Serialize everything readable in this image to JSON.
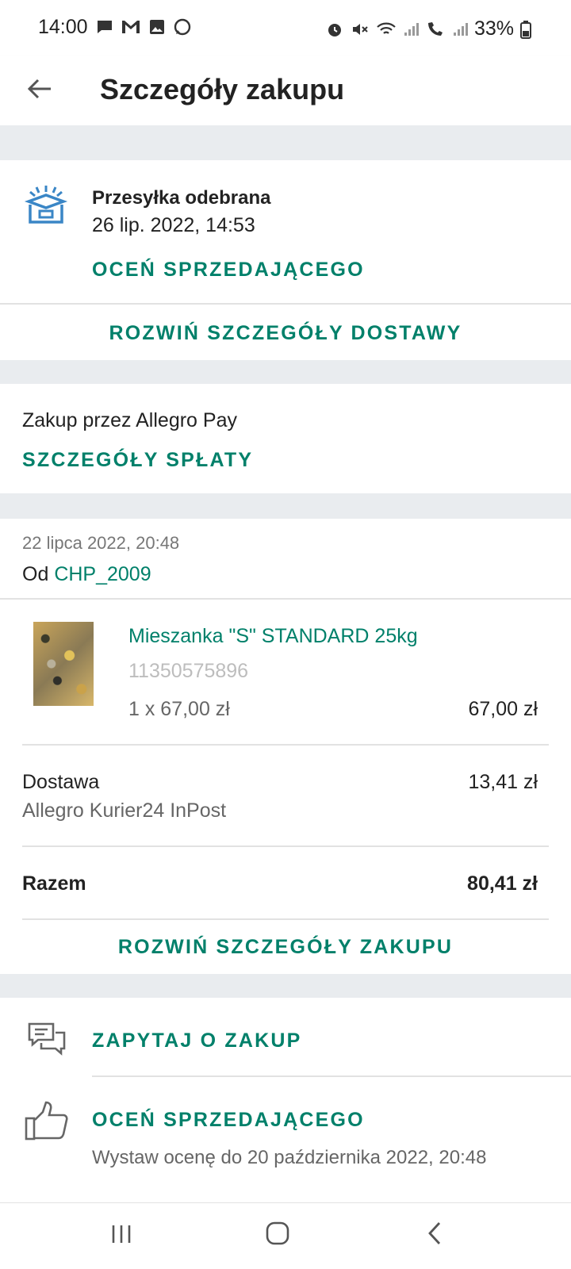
{
  "status_bar": {
    "time": "14:00",
    "battery": "33%",
    "icons_left": [
      "message-icon",
      "gmail-icon",
      "gallery-icon",
      "whatsapp-icon"
    ],
    "icons_right": [
      "alarm-icon",
      "mute-icon",
      "wifi-icon",
      "signal-icon",
      "wifi-call-icon",
      "signal-icon",
      "battery-icon"
    ]
  },
  "app_bar": {
    "title": "Szczegóły zakupu",
    "back_icon": "arrow-left-icon"
  },
  "delivery": {
    "status": "Przesyłka odebrana",
    "datetime": "26 lip. 2022, 14:53",
    "rate_seller_label": "OCEŃ SPRZEDAJĄCEGO",
    "expand_label": "ROZWIŃ SZCZEGÓŁY DOSTAWY"
  },
  "payment": {
    "text": "Zakup przez Allegro Pay",
    "details_label": "SZCZEGÓŁY SPŁATY"
  },
  "order": {
    "date": "22 lipca 2022, 20:48",
    "from_prefix": "Od",
    "seller": "CHP_2009",
    "item": {
      "name": "Mieszanka \"S\" STANDARD 25kg",
      "id": "11350575896",
      "qty_price": "1 x 67,00 zł",
      "total": "67,00 zł"
    },
    "shipping": {
      "label": "Dostawa",
      "method": "Allegro Kurier24 InPost",
      "price": "13,41 zł"
    },
    "sum": {
      "label": "Razem",
      "value": "80,41 zł"
    },
    "expand_label": "ROZWIŃ SZCZEGÓŁY ZAKUPU"
  },
  "actions": {
    "ask_label": "ZAPYTAJ O ZAKUP",
    "rate_label": "OCEŃ SPRZEDAJĄCEGO",
    "rate_note": "Wystaw ocenę do 20 października 2022, 20:48"
  },
  "colors": {
    "accent": "#00806a",
    "divider": "#e2e2e2",
    "band": "#e9ecef"
  }
}
